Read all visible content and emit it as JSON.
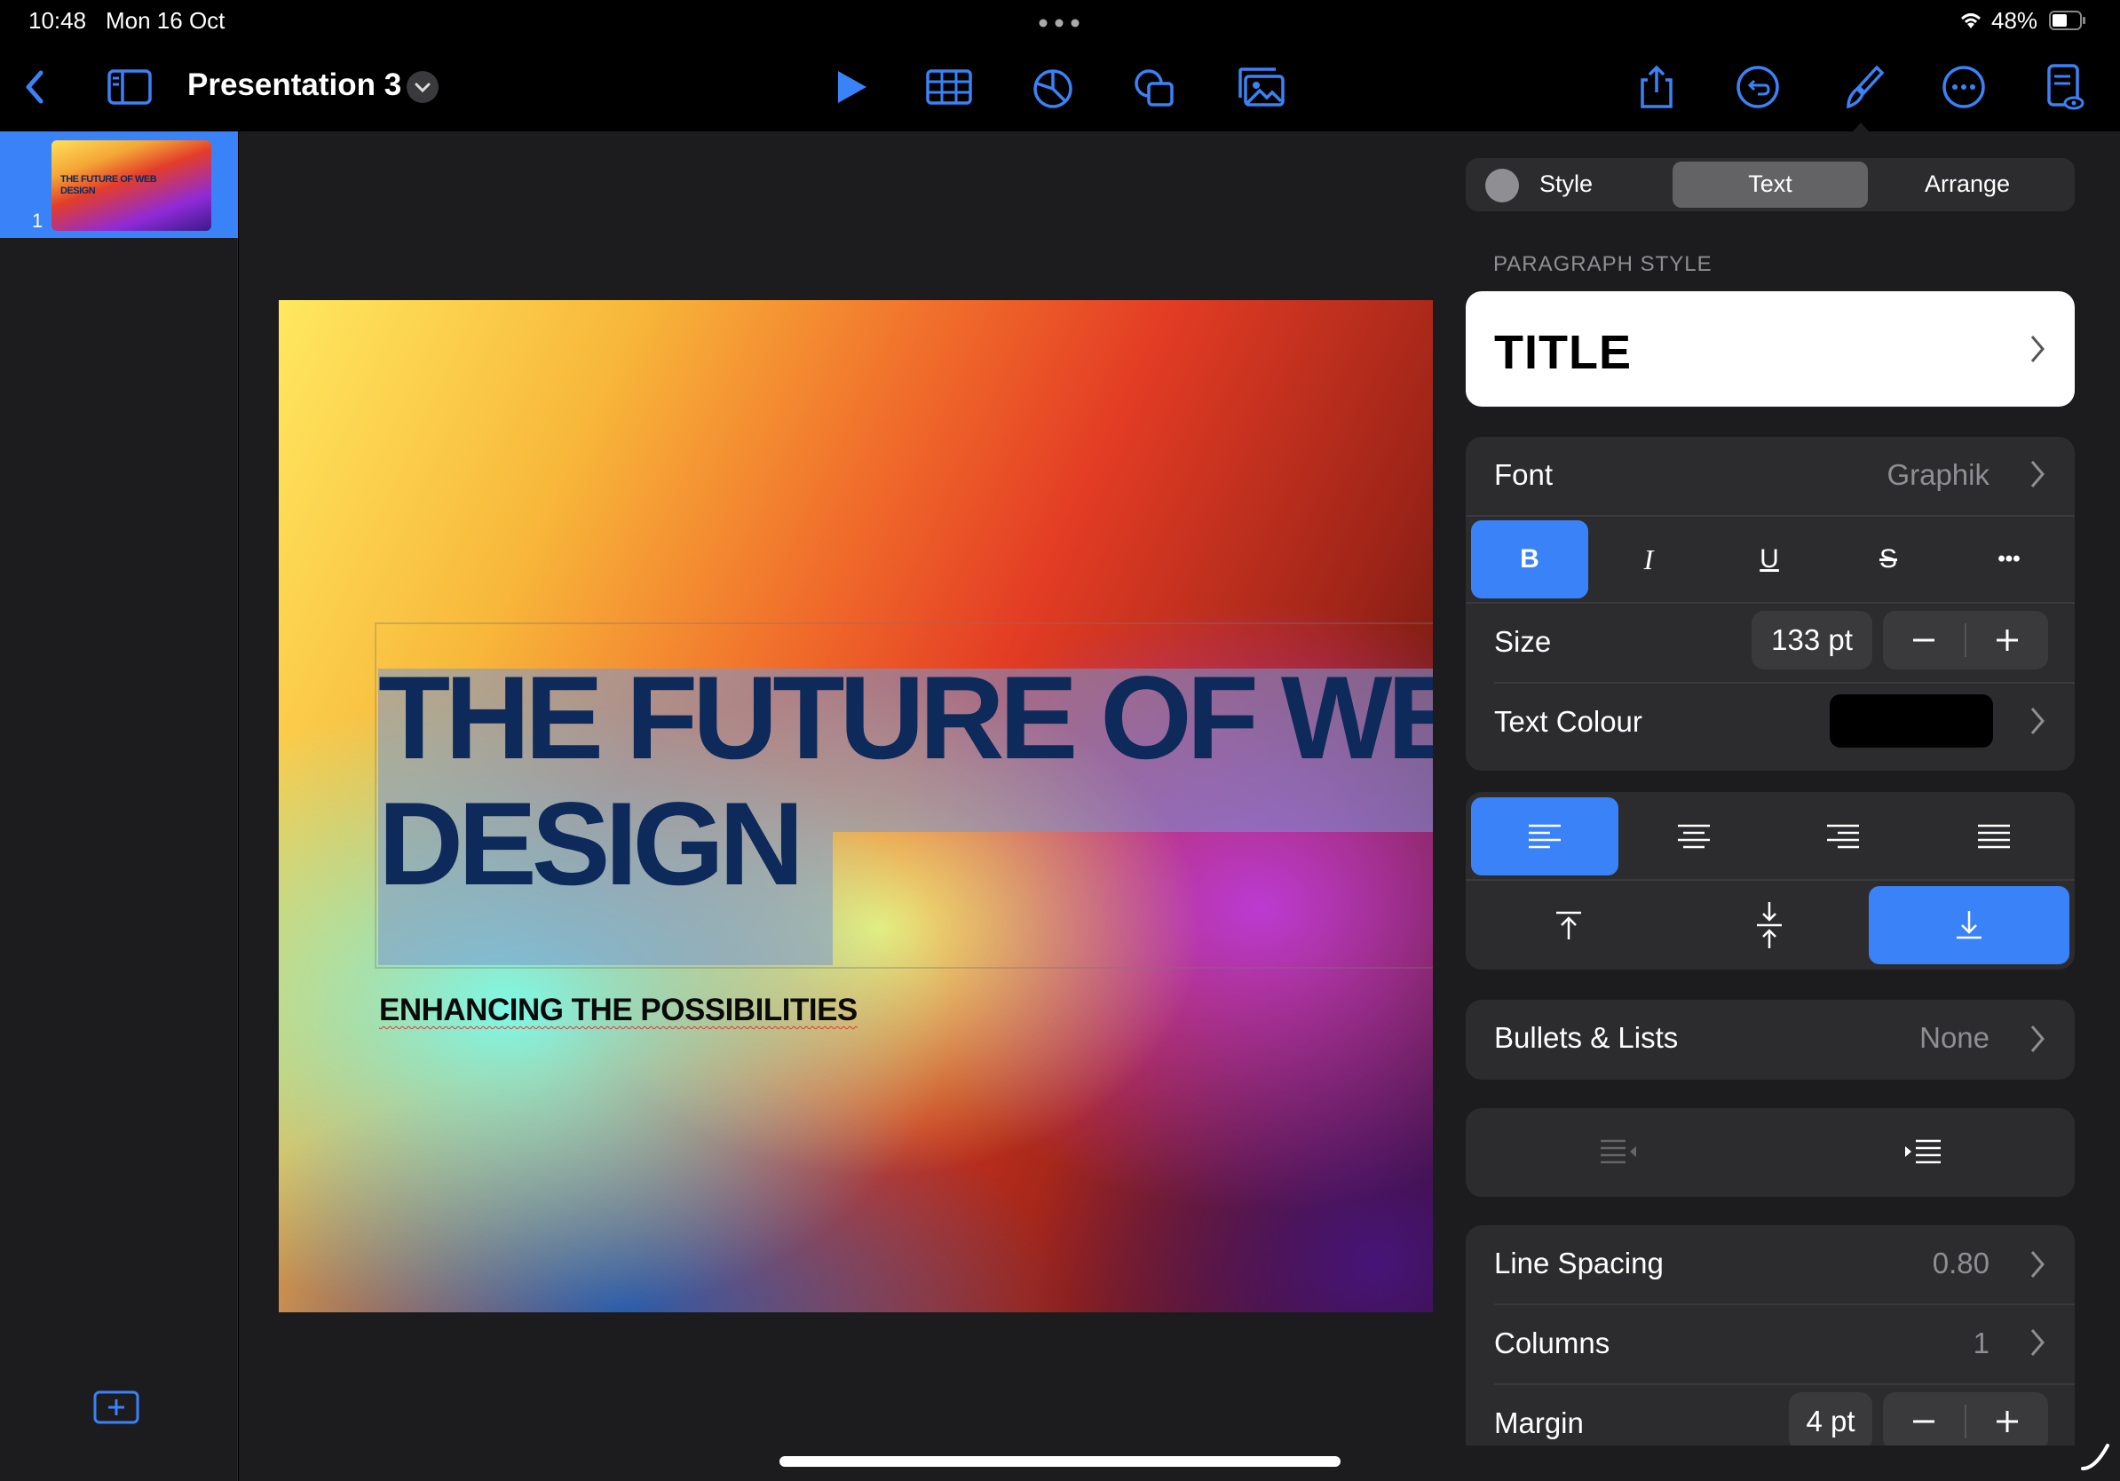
{
  "status": {
    "time": "10:48",
    "date": "Mon 16 Oct",
    "battery": "48%"
  },
  "toolbar": {
    "doc_title": "Presentation 3"
  },
  "sidebar": {
    "slide_number": "1",
    "thumb_title": "THE FUTURE OF WEB\nDESIGN"
  },
  "slide": {
    "title": "THE FUTURE OF WEB\nDESIGN",
    "subtitle": "ENHANCING THE POSSIBILITIES"
  },
  "panel": {
    "tabs": [
      "Style",
      "Text",
      "Arrange"
    ],
    "active_tab": "Text",
    "paragraph_style_header": "PARAGRAPH STYLE",
    "paragraph_style": "TITLE",
    "font_label": "Font",
    "font_value": "Graphik",
    "format_buttons": [
      "B",
      "I",
      "U",
      "S",
      "•••"
    ],
    "size_label": "Size",
    "size_value": "133 pt",
    "text_colour_label": "Text Colour",
    "text_colour": "#000000",
    "bullets_label": "Bullets & Lists",
    "bullets_value": "None",
    "line_spacing_label": "Line Spacing",
    "line_spacing_value": "0.80",
    "columns_label": "Columns",
    "columns_value": "1",
    "margin_label": "Margin",
    "margin_value": "4 pt"
  },
  "colors": {
    "accent": "#3a82f7",
    "panel_bg": "#1c1c1e",
    "group_bg": "#2c2c2e"
  }
}
